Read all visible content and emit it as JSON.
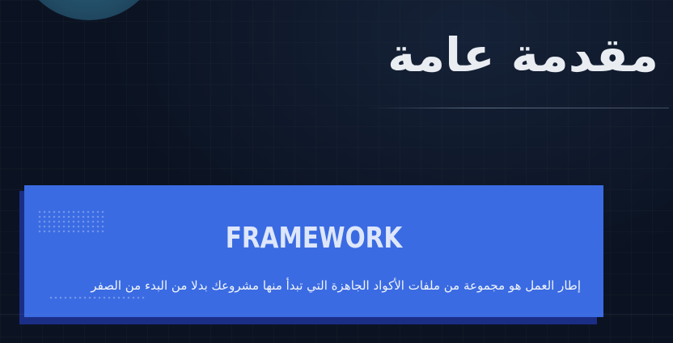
{
  "slide": {
    "title": "مقدمة عامة",
    "card": {
      "heading": "FRAMEWORK",
      "text": "إطار العمل هو مجموعة من ملفات الأكواد الجاهزة التي تبدأ منها مشروعك بدلا من البدء من الصفر"
    }
  },
  "colors": {
    "background": "#0b1322",
    "card": "#3a6be2",
    "card_shadow": "#1b2e86",
    "title": "#e9edf2"
  }
}
